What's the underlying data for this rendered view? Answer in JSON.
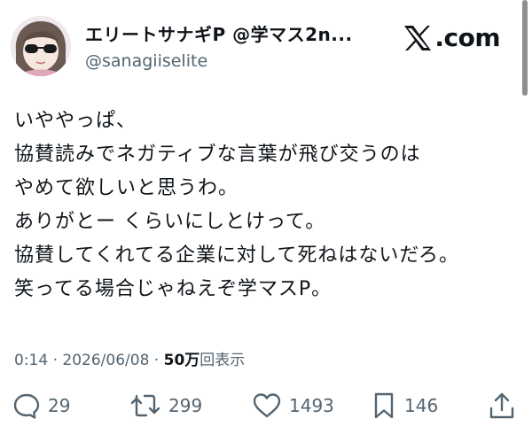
{
  "author": {
    "display_name": "エリートサナギP @学マス2n...",
    "handle": "@sanagiiselite"
  },
  "brand": {
    "label": ".com"
  },
  "post": {
    "lines": [
      "いややっぱ、",
      "協賛読みでネガティブな言葉が飛び交うのは",
      "やめて欲しいと思うわ。",
      "ありがとー くらいにしとけって。",
      "協賛してくれてる企業に対して死ねはないだろ。",
      "笑ってる場合じゃねえぞ学マスP。"
    ]
  },
  "meta": {
    "time": "0:14",
    "separator1": "·",
    "date": "2026/06/08",
    "separator2": "·",
    "views_count": "50万",
    "views_label": "回表示"
  },
  "actions": {
    "replies": "29",
    "reposts": "299",
    "likes": "1493",
    "bookmarks": "146"
  },
  "colors": {
    "text": "#0f1419",
    "secondary": "#536471"
  }
}
